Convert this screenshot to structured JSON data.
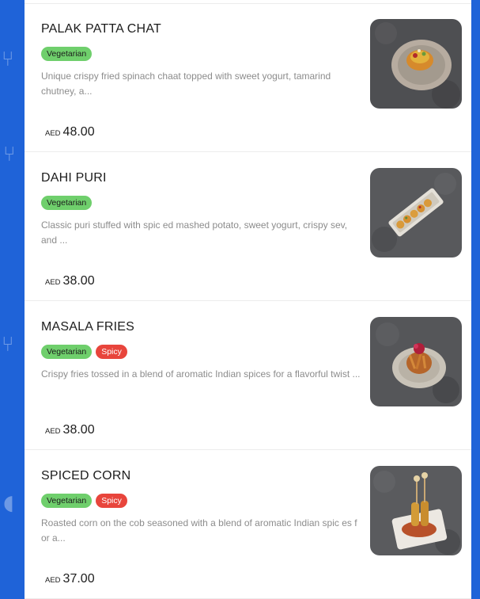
{
  "menu": {
    "items": [
      {
        "title": "PALAK PATTA CHAT",
        "tags": [
          "Vegetarian"
        ],
        "description": "Unique crispy fried spinach chaat topped with sweet yogurt, tamarind chutney, a...",
        "currency": "AED",
        "price": "48.00",
        "image_icon": "plate-chaat-icon"
      },
      {
        "title": "DAHI PURI",
        "tags": [
          "Vegetarian"
        ],
        "description": "Classic puri stuffed with spic ed mashed potato, sweet yogurt, crispy sev, and ...",
        "currency": "AED",
        "price": "38.00",
        "image_icon": "tray-puri-icon"
      },
      {
        "title": "MASALA FRIES",
        "tags": [
          "Vegetarian",
          "Spicy"
        ],
        "description": "Crispy fries tossed in a blend of aromatic Indian spices for a flavorful twist ...",
        "currency": "AED",
        "price": "38.00",
        "image_icon": "plate-fries-icon"
      },
      {
        "title": "SPICED CORN",
        "tags": [
          "Vegetarian",
          "Spicy"
        ],
        "description": "Roasted corn on the cob seasoned with a blend of aromatic Indian spic es f or a...",
        "currency": "AED",
        "price": "37.00",
        "image_icon": "plate-corn-icon"
      }
    ]
  },
  "colors": {
    "background": "#1f63d8",
    "vegetarian_tag": "#6fcf6c",
    "spicy_tag": "#e8453c"
  }
}
